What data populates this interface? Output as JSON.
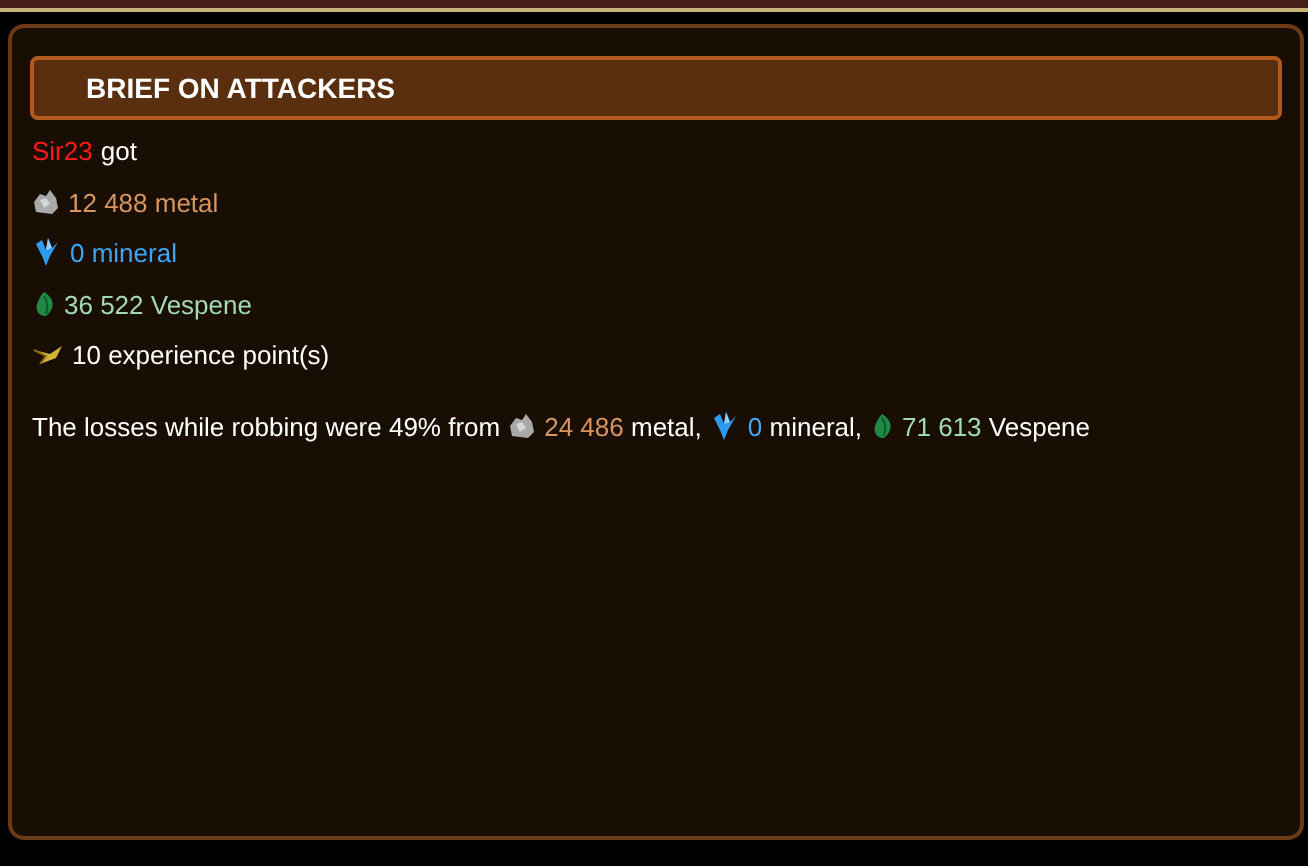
{
  "panel": {
    "title": "BRIEF ON ATTACKERS"
  },
  "attacker": {
    "name": "Sir23",
    "verb": "got"
  },
  "loot": [
    {
      "kind": "metal",
      "text": "12 488 metal"
    },
    {
      "kind": "mineral",
      "text": "0 mineral"
    },
    {
      "kind": "vespene",
      "text": "36 522 Vespene"
    },
    {
      "kind": "experience",
      "text": "10 experience point(s)"
    }
  ],
  "losses": {
    "text": "The losses while robbing were 49% from",
    "items": [
      {
        "kind": "metal",
        "amount": "24 486",
        "label": "metal,"
      },
      {
        "kind": "mineral",
        "amount": "0",
        "label": "mineral,"
      },
      {
        "kind": "vespene",
        "amount": "71 613",
        "label": "Vespene"
      }
    ]
  }
}
